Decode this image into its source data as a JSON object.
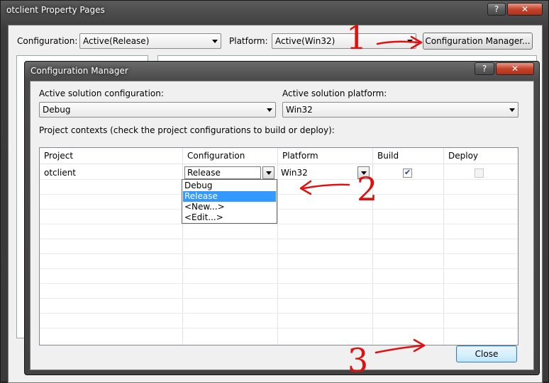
{
  "outer": {
    "title": "otclient Property Pages",
    "help_button": "?",
    "close_button": "✕",
    "configuration_label": "Configuration:",
    "configuration_value": "Active(Release)",
    "platform_label": "Platform:",
    "platform_value": "Active(Win32)",
    "config_manager_button": "Configuration Manager..."
  },
  "dialog": {
    "title": "Configuration Manager",
    "help_button": "?",
    "close_button": "✕",
    "solution_config_label": "Active solution configuration:",
    "solution_config_value": "Debug",
    "solution_platform_label": "Active solution platform:",
    "solution_platform_value": "Win32",
    "contexts_label": "Project contexts (check the project configurations to build or deploy):",
    "columns": [
      "Project",
      "Configuration",
      "Platform",
      "Build",
      "Deploy"
    ],
    "row": {
      "project": "otclient",
      "configuration": "Release",
      "platform": "Win32",
      "build_checked": true,
      "deploy_checked": false
    },
    "dropdown_options": [
      "Debug",
      "Release",
      "<New...>",
      "<Edit...>"
    ],
    "dropdown_selected": "Release",
    "close_label": "Close"
  },
  "annotations": {
    "one": "1",
    "two": "2",
    "three": "3",
    "color": "#e01010"
  }
}
